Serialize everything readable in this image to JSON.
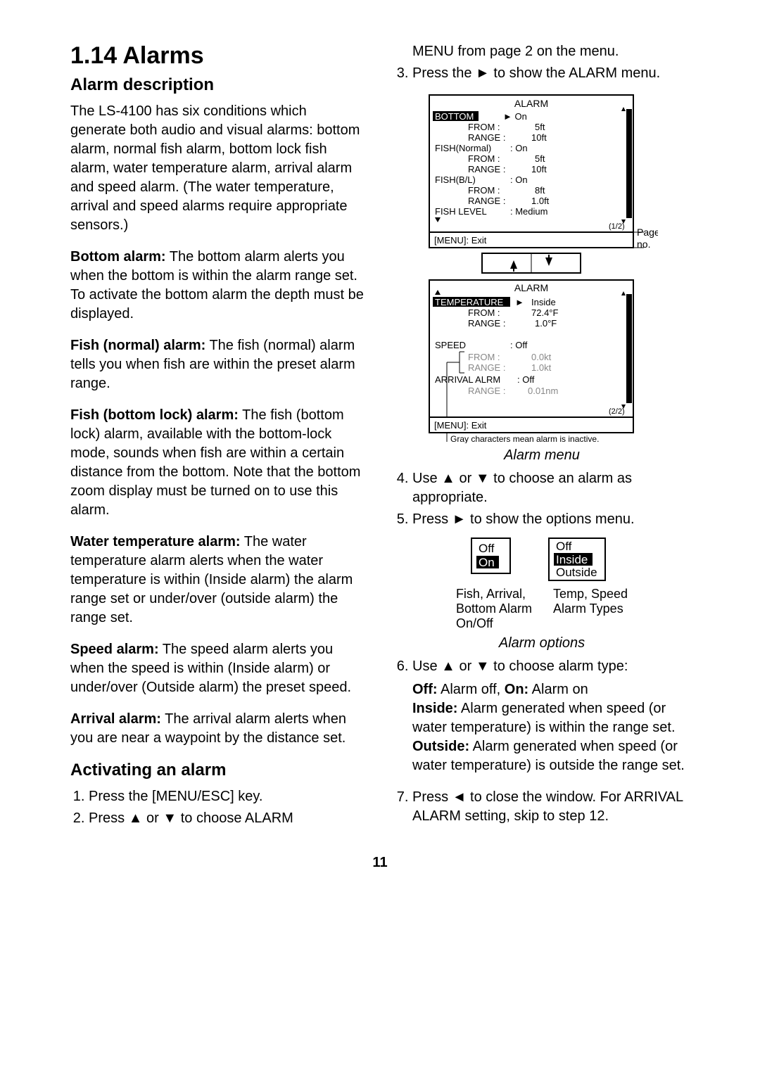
{
  "heading": "1.14 Alarms",
  "sub1": "Alarm description",
  "intro": "The LS-4100 has six conditions which generate both audio and visual alarms: bottom alarm, normal fish alarm, bottom lock fish alarm, water temperature alarm, arrival alarm and speed alarm. (The water temperature, arrival and speed alarms require appropriate sensors.)",
  "bottom_alarm_label": "Bottom alarm:",
  "bottom_alarm_text": " The bottom alarm alerts you when the bottom is within the alarm range set. To activate the bottom alarm the depth must be displayed.",
  "fish_normal_label": "Fish (normal) alarm:",
  "fish_normal_text": " The fish (normal) alarm tells you when fish are within the preset alarm range.",
  "fish_bl_label": "Fish (bottom lock) alarm:",
  "fish_bl_text": " The fish (bottom lock) alarm, available with the bottom-lock mode, sounds when fish are within a certain distance from the bottom. Note that the bottom zoom display must be turned on to use this alarm.",
  "water_temp_label": "Water temperature alarm:",
  "water_temp_text": " The water temperature alarm alerts when the water temperature is within (Inside alarm) the alarm range set or under/over (outside alarm) the range set.",
  "speed_label": "Speed alarm:",
  "speed_text": " The speed alarm alerts you when the speed is within (Inside alarm) or under/over (Outside alarm) the preset speed.",
  "arrival_label": "Arrival alarm:",
  "arrival_text": " The arrival alarm alerts when you are near a waypoint by the distance set.",
  "sub2": "Activating an alarm",
  "step1": "Press the [MENU/ESC] key.",
  "step2": "Press ▲ or ▼ to choose ALARM",
  "step2_cont": "MENU from page 2 on the menu.",
  "step3": "Press the ► to show the ALARM menu.",
  "alarm_menu_caption": "Alarm menu",
  "step4": "Use ▲ or ▼ to choose an alarm as appropriate.",
  "step5": "Press ► to show the options menu.",
  "alarm_options_caption": "Alarm options",
  "opt_left1": "Fish, Arrival,",
  "opt_left2": "Bottom Alarm",
  "opt_left3": "On/Off",
  "opt_right1": "Temp, Speed",
  "opt_right2": "Alarm Types",
  "step6": "Use ▲ or ▼ to choose alarm type:",
  "off_label": "Off:",
  "off_text": " Alarm off, ",
  "on_label": "On:",
  "on_text": " Alarm on",
  "inside_label": "Inside:",
  "inside_text": " Alarm generated when speed (or water temperature) is within the range set.",
  "outside_label": "Outside:",
  "outside_text": " Alarm generated when speed (or water temperature) is outside the range set.",
  "step7": "Press ◄ to close the window. For ARRIVAL ALARM setting, skip to step 12.",
  "page_no_label": "Page no.",
  "gray_note": "Gray characters mean alarm is inactive.",
  "menu1": {
    "title": "ALARM",
    "bottom": "BOTTOM",
    "bottom_val": "► On",
    "from": "FROM",
    "range": "RANGE",
    "b_from": "5ft",
    "b_range": "10ft",
    "fishn": "FISH(Normal)",
    "fishn_val": ": On",
    "fn_from": "5ft",
    "fn_range": "10ft",
    "fishbl": "FISH(B/L)",
    "fishbl_val": ": On",
    "fbl_from": "8ft",
    "fbl_range": "1.0ft",
    "fish_level": "FISH LEVEL",
    "fish_level_val": ": Medium",
    "exit": "[MENU]: Exit",
    "page": "(1/2)"
  },
  "menu2": {
    "title": "ALARM",
    "temp": "TEMPERATURE",
    "temp_val": "Inside",
    "t_from": "72.4°F",
    "t_range": "1.0°F",
    "speed": "SPEED",
    "speed_val": ": Off",
    "s_from": "0.0kt",
    "s_range": "1.0kt",
    "arrival": "ARRIVAL ALRM",
    "arrival_val": ": Off",
    "a_range": "0.01nm",
    "exit": "[MENU]: Exit",
    "page": "(2/2)"
  },
  "off_opt": "Off",
  "on_opt": "On",
  "inside_opt": "Inside",
  "outside_opt": "Outside",
  "page_number": "11"
}
